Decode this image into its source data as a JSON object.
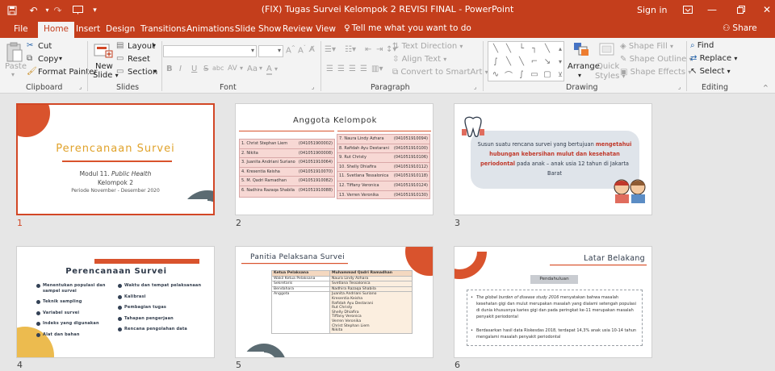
{
  "app": {
    "title": "(FIX) Tugas Survei Kelompok 2 REVISI FINAL  -  PowerPoint",
    "sign_in": "Sign in",
    "accent_color": "#c43e1c"
  },
  "tabs": [
    "File",
    "Home",
    "Insert",
    "Design",
    "Transitions",
    "Animations",
    "Slide Show",
    "Review",
    "View"
  ],
  "tell_me": "Tell me what you want to do",
  "share": "Share",
  "ribbon": {
    "clipboard": {
      "paste": "Paste",
      "cut": "Cut",
      "copy": "Copy",
      "format_painter": "Format Painter",
      "label": "Clipboard"
    },
    "slides": {
      "new": "New",
      "slide": "Slide",
      "layout": "Layout",
      "reset": "Reset",
      "section": "Section",
      "label": "Slides"
    },
    "font": {
      "bold": "B",
      "italic": "I",
      "underline": "U",
      "strike": "S",
      "shadow": "abc",
      "spacing": "AV",
      "case": "Aa",
      "label": "Font"
    },
    "paragraph": {
      "text_direction": "Text Direction",
      "align_text": "Align Text",
      "convert": "Convert to SmartArt",
      "label": "Paragraph"
    },
    "drawing": {
      "arrange": "Arrange",
      "quick": "Quick",
      "styles": "Styles",
      "shape_fill": "Shape Fill",
      "shape_outline": "Shape Outline",
      "shape_effects": "Shape Effects",
      "label": "Drawing"
    },
    "editing": {
      "find": "Find",
      "replace": "Replace",
      "select": "Select",
      "label": "Editing"
    }
  },
  "slides": [
    {
      "number": "1",
      "title": "Perencanaan Survei",
      "line1_prefix": "Modul 11. ",
      "line1_italic": "Public Health",
      "line2": "Kelompok 2",
      "line3": "Periode November - Desember 2020"
    },
    {
      "number": "2",
      "title": "Anggota Kelompok",
      "left": [
        {
          "name": "1. Christ Stephan Liem",
          "nim": "(041051900002)"
        },
        {
          "name": "2. Nikita",
          "nim": "(041051900008)"
        },
        {
          "name": "3. Juanita Andriani Suriano",
          "nim": "(041051910064)"
        },
        {
          "name": "4. Kresentia Keisha",
          "nim": "(041051910070)"
        },
        {
          "name": "5. M. Qadri Ramadhan",
          "nim": "(041051910082)"
        },
        {
          "name": "6. Nadhira Razaqa Shabila",
          "nim": "(041051910088)"
        }
      ],
      "right": [
        {
          "name": "7.    Naura Lindy Azhara",
          "nim": "(041051910094)"
        },
        {
          "name": "8.    Rafidah Ayu Destarani",
          "nim": "(041051910100)"
        },
        {
          "name": "9.    Rut Christy",
          "nim": "(041051910106)"
        },
        {
          "name": "10. Shelly Dhiafira",
          "nim": "(041051910112)"
        },
        {
          "name": "11. Svetlana Tessalonica",
          "nim": "(041051910118)"
        },
        {
          "name": "12. Tiffany Veronica",
          "nim": "(041051910124)"
        },
        {
          "name": "13. Verren Veronika",
          "nim": "(041051910130)"
        }
      ]
    },
    {
      "number": "3",
      "text_a": "Susun suatu rencana survei yang bertujuan ",
      "text_b": "mengetahui hubungan kebersihan mulut dan kesehatan periodontal",
      "text_c": " pada anak – anak usia 12 tahun di Jakarta Barat"
    },
    {
      "number": "4",
      "title": "Perencanaan Survei",
      "left": [
        "Menentukan populasi dan sampel survei",
        "Teknik sampling",
        "Variabel survei",
        "Indeks yang digunakan",
        "Alat dan bahan"
      ],
      "right": [
        "Waktu dan tempat pelaksanaan",
        "Kalibrasi",
        "Pembagian tugas",
        "Tahapan pengerjaan",
        "Rencana pengolahan data"
      ]
    },
    {
      "number": "5",
      "title": "Panitia Pelaksana Survei",
      "rows": [
        [
          "Ketua Pelaksana",
          "Muhammad Qadri Ramadhan"
        ],
        [
          "Wakil Ketua Pelaksana",
          "Naura Lindy Azhara"
        ],
        [
          "Sekretaris",
          "Svetlana Tessalonica"
        ],
        [
          "Bendahara",
          "Nadhira Razaqa Shabila"
        ]
      ],
      "anggota_label": "Anggota",
      "anggota": [
        "Juanita Andriani Suriano",
        "Kresentia Keisha",
        "Rafidah Ayu Destarani",
        "Rut Christy",
        "Shelly Dhiafira",
        "Tiffany Veronica",
        "Verren Veronika",
        "Christ Stephan Liem",
        "Nikita"
      ]
    },
    {
      "number": "6",
      "title": "Latar Belakang",
      "badge": "Pendahuluan",
      "b1_italic": "The global burden of disease study 2016",
      "b1_rest": " menyatakan bahwa masalah kesehatan gigi dan mulut merupakan masalah yang dialami setengah populasi di dunia khususnya karies gigi dan pada peringkat ke-11 merupakan masalah penyakit periodontal",
      "b2": "Berdasarkan hasil data Riskesdas 2018, terdapat 14,3% anak usia 10-14 tahun mengalami masalah penyakit periodontal"
    }
  ]
}
